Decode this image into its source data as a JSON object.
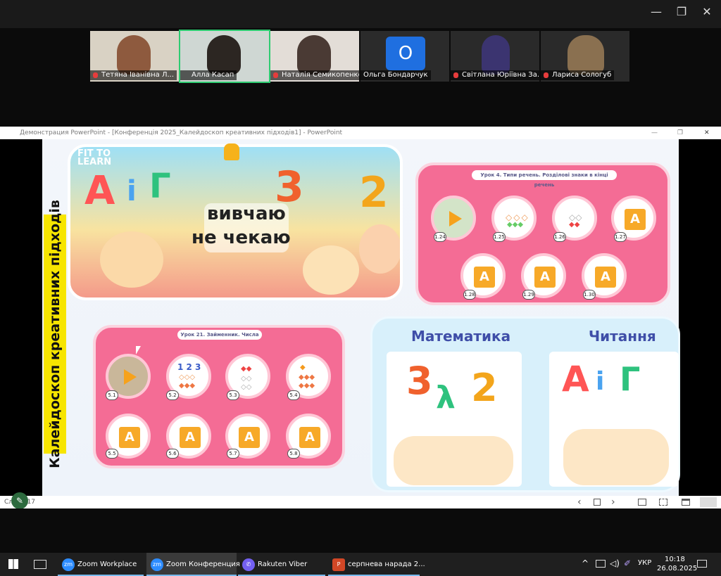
{
  "zoom": {
    "window_controls": {
      "minimize": "—",
      "restore": "❐",
      "close": "✕"
    },
    "participants": [
      {
        "name": "Тетяна Іванівна Л..."
      },
      {
        "name": "Алла Касап"
      },
      {
        "name": "Наталія Семикопенко"
      },
      {
        "name": "Ольга Бондарчук",
        "initial": "О"
      },
      {
        "name": "Світлана Юріївна За..."
      },
      {
        "name": "Лариса Сологуб"
      }
    ]
  },
  "powerpoint": {
    "title": "Демонстрация PowerPoint - [Конференція 2025_Калейдоскоп креативних підходів1] - PowerPoint",
    "status_left": "Слайд 17",
    "controls": {
      "prev": "‹",
      "next": "›",
      "minimize": "—",
      "restore": "❐",
      "close": "✕"
    }
  },
  "slide": {
    "side_title": "Калейдоскоп креативних підходів",
    "banner": {
      "logo": "FIT TO LEARN",
      "line1": "вивчаю",
      "line2": "не чекаю"
    },
    "lesson4": {
      "label": "Урок 4. Типи речень. Розділові знаки в кінці речень",
      "items": [
        "1.24",
        "1.25",
        "1.26",
        "1.27",
        "1.28",
        "1.29",
        "1.30"
      ]
    },
    "lesson21": {
      "label": "Урок 21. Займенник. Числа",
      "items": [
        "5.1",
        "5.2",
        "5.3",
        "5.4",
        "5.5",
        "5.6",
        "5.7",
        "5.8"
      ],
      "digits": "1 2 3"
    },
    "subjects": [
      "Математика",
      "Читання"
    ]
  },
  "taskbar": {
    "items": [
      "Zoom Workplace",
      "Zoom Конференция",
      "Rakuten Viber",
      "серпнева нарада 2..."
    ],
    "lang": "УКР",
    "time": "10:18",
    "date": "26.08.2025"
  }
}
